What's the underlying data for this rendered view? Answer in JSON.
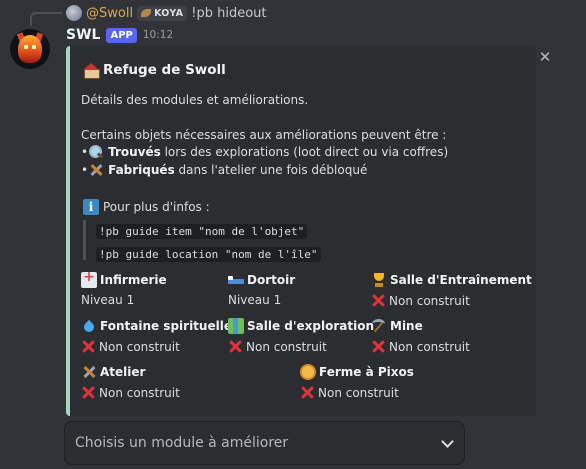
{
  "reply": {
    "username": "@Swoll",
    "tag": "KOYA",
    "command": "!pb hideout"
  },
  "message": {
    "author": "SWL",
    "badge": "APP",
    "time": "10:12"
  },
  "embed": {
    "accent_color": "#a3d7c0",
    "title": "Refuge de Swoll",
    "title_icon": "house-icon",
    "subtitle": "Détails des modules et améliorations.",
    "intro": "Certains objets nécessaires aux améliorations peuvent être :",
    "bullets": [
      {
        "prefix": "• ",
        "icon": "magnifier-icon",
        "bold": "Trouvés",
        "rest": " lors des explorations (loot direct ou via coffres)"
      },
      {
        "prefix": "• ",
        "icon": "tools-icon",
        "bold": "Fabriqués",
        "rest": " dans l'atelier une fois débloqué"
      }
    ],
    "info_label": "Pour plus d'infos :",
    "info_icon": "info-icon",
    "commands": [
      "!pb guide item \"nom de l'objet\"",
      "!pb guide location \"nom de l'île\""
    ],
    "fields": [
      {
        "name": "Infirmerie",
        "value": "Niveau 1",
        "icon": "hospital-icon",
        "status": "level"
      },
      {
        "name": "Dortoir",
        "value": "Niveau 1",
        "icon": "bed-icon",
        "status": "level"
      },
      {
        "name": "Salle d'Entraînement",
        "value": "Non construit",
        "icon": "trophy-icon",
        "status": "none"
      },
      {
        "name": "Fontaine spirituelle",
        "value": "Non construit",
        "icon": "droplet-icon",
        "status": "none"
      },
      {
        "name": "Salle d'exploration",
        "value": "Non construit",
        "icon": "map-icon",
        "status": "none"
      },
      {
        "name": "Mine",
        "value": "Non construit",
        "icon": "pickaxe-icon",
        "status": "none"
      },
      {
        "name": "Atelier",
        "value": "Non construit",
        "icon": "tools-icon",
        "status": "none"
      },
      {
        "name": "Ferme à Pixos",
        "value": "Non construit",
        "icon": "coin-icon",
        "status": "none"
      }
    ]
  },
  "select_menu": {
    "placeholder": "Choisis un module à améliorer"
  },
  "colors": {
    "background": "#323339",
    "embed_background": "#2b2d31",
    "app_badge": "#5865f2",
    "reply_name": "#e0a84d",
    "not_built_x": "#e0343c"
  }
}
